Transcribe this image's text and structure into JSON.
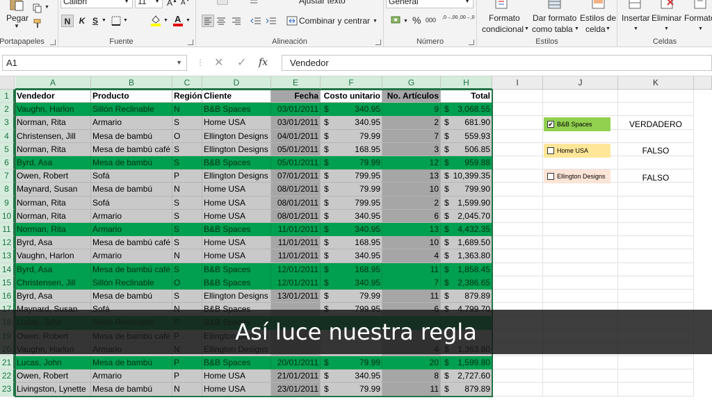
{
  "ribbon": {
    "clipboard": {
      "paste_label": "Pegar",
      "group_label": "Portapapeles"
    },
    "font": {
      "font_name": "Calibri",
      "font_size": "11",
      "bold": "N",
      "italic": "K",
      "underline": "S",
      "group_label": "Fuente",
      "font_color": "#e00000",
      "fill_color": "#ffff00"
    },
    "alignment": {
      "wrap_text": "Ajustar texto",
      "merge_center": "Combinar y centrar",
      "group_label": "Alineación"
    },
    "number": {
      "format": "General",
      "percent": "%",
      "thousands": "000",
      "inc_decimal": ",0→,00",
      "dec_decimal": ",00→,0",
      "group_label": "Número"
    },
    "styles": {
      "conditional_format": [
        "Formato",
        "condicional"
      ],
      "format_table": [
        "Dar formato",
        "como tabla"
      ],
      "cell_styles": [
        "Estilos de",
        "celda"
      ],
      "group_label": "Estilos"
    },
    "cells": {
      "insert": "Insertar",
      "delete": "Eliminar",
      "format": "Formato",
      "group_label": "Celdas"
    }
  },
  "formula_bar": {
    "cell_ref": "A1",
    "content": "Vendedor",
    "fx": "fx"
  },
  "grid": {
    "columns": [
      "A",
      "B",
      "C",
      "D",
      "E",
      "F",
      "G",
      "H",
      "I",
      "J",
      "K"
    ],
    "headers": [
      "Vendedor",
      "Producto",
      "Región",
      "Cliente",
      "Fecha",
      "Costo unitario",
      "No. Artículos",
      "Total"
    ],
    "currency_symbol": "$",
    "rows": [
      {
        "n": "2",
        "hl": true,
        "c": [
          "Vaughn, Harlon",
          "Sillón Reclinable",
          "N",
          "B&B Spaces",
          "03/01/2011",
          "340.95",
          "9",
          "3,068.55"
        ]
      },
      {
        "n": "3",
        "hl": false,
        "c": [
          "Norman, Rita",
          "Armario",
          "S",
          "Home USA",
          "03/01/2011",
          "340.95",
          "2",
          "681.90"
        ]
      },
      {
        "n": "4",
        "hl": false,
        "c": [
          "Christensen, Jill",
          "Mesa de bambú",
          "O",
          "Ellington Designs",
          "04/01/2011",
          "79.99",
          "7",
          "559.93"
        ]
      },
      {
        "n": "5",
        "hl": false,
        "c": [
          "Norman, Rita",
          "Mesa de bambú café",
          "S",
          "Ellington Designs",
          "05/01/2011",
          "168.95",
          "3",
          "506.85"
        ]
      },
      {
        "n": "6",
        "hl": true,
        "c": [
          "Byrd, Asa",
          "Mesa de bambú",
          "S",
          "B&B Spaces",
          "05/01/2011",
          "79.99",
          "12",
          "959.88"
        ]
      },
      {
        "n": "7",
        "hl": false,
        "c": [
          "Owen, Robert",
          "Sofá",
          "P",
          "Ellington Designs",
          "07/01/2011",
          "799.95",
          "13",
          "10,399.35"
        ]
      },
      {
        "n": "8",
        "hl": false,
        "c": [
          "Maynard, Susan",
          "Mesa de bambú",
          "N",
          "Home USA",
          "08/01/2011",
          "79.99",
          "10",
          "799.90"
        ]
      },
      {
        "n": "9",
        "hl": false,
        "c": [
          "Norman, Rita",
          "Sofá",
          "S",
          "Home USA",
          "08/01/2011",
          "799.95",
          "2",
          "1,599.90"
        ]
      },
      {
        "n": "10",
        "hl": false,
        "c": [
          "Norman, Rita",
          "Armario",
          "S",
          "Home USA",
          "08/01/2011",
          "340.95",
          "6",
          "2,045.70"
        ]
      },
      {
        "n": "11",
        "hl": true,
        "c": [
          "Norman, Rita",
          "Armario",
          "S",
          "B&B Spaces",
          "11/01/2011",
          "340.95",
          "13",
          "4,432.35"
        ]
      },
      {
        "n": "12",
        "hl": false,
        "c": [
          "Byrd, Asa",
          "Mesa de bambú café",
          "S",
          "Home USA",
          "11/01/2011",
          "168.95",
          "10",
          "1,689.50"
        ]
      },
      {
        "n": "13",
        "hl": false,
        "c": [
          "Vaughn, Harlon",
          "Armario",
          "N",
          "Home USA",
          "11/01/2011",
          "340.95",
          "4",
          "1,363.80"
        ]
      },
      {
        "n": "14",
        "hl": true,
        "c": [
          "Byrd, Asa",
          "Mesa de bambú café",
          "S",
          "B&B Spaces",
          "12/01/2011",
          "168.95",
          "11",
          "1,858.45"
        ]
      },
      {
        "n": "15",
        "hl": true,
        "c": [
          "Christensen, Jill",
          "Sillón Reclinable",
          "O",
          "B&B Spaces",
          "12/01/2011",
          "340.95",
          "7",
          "2,386.65"
        ]
      },
      {
        "n": "16",
        "hl": false,
        "c": [
          "Byrd, Asa",
          "Mesa de bambú",
          "S",
          "Ellington Designs",
          "13/01/2011",
          "79.99",
          "11",
          "879.89"
        ]
      },
      {
        "n": "17",
        "hl": false,
        "c": [
          "Maynard, Susan",
          "Sofá",
          "N",
          "B&B Spaces",
          "",
          "799.95",
          "6",
          "4,799.70"
        ]
      },
      {
        "n": "18",
        "hl": true,
        "c": [
          "Lucas, John",
          "Sillón Reclinable",
          "P",
          "B&B Spaces",
          "",
          "",
          "",
          ""
        ]
      },
      {
        "n": "19",
        "hl": false,
        "c": [
          "Owen, Robert",
          "Mesa de bambú café",
          "P",
          "Ellington Designs",
          "",
          "",
          "",
          ""
        ]
      },
      {
        "n": "20",
        "hl": false,
        "c": [
          "Vaughn, Harlon",
          "Armario",
          "N",
          "Ellington Designs",
          "",
          "",
          "4",
          "1,363.80"
        ]
      },
      {
        "n": "21",
        "hl": true,
        "c": [
          "Lucas, John",
          "Mesa de bambú",
          "P",
          "B&B Spaces",
          "20/01/2011",
          "79.99",
          "20",
          "1,599.80"
        ]
      },
      {
        "n": "22",
        "hl": false,
        "c": [
          "Owen, Robert",
          "Armario",
          "P",
          "Home USA",
          "21/01/2011",
          "340.95",
          "8",
          "2,727.60"
        ]
      },
      {
        "n": "23",
        "hl": false,
        "c": [
          "Livingston, Lynette",
          "Mesa de bambú",
          "N",
          "Home USA",
          "23/01/2011",
          "79.99",
          "11",
          "879.89"
        ]
      }
    ]
  },
  "controls": {
    "checkboxes": [
      {
        "label": "B&B Spaces",
        "checked": true,
        "mark": "✔",
        "bg": "#92d050",
        "result": "VERDADERO"
      },
      {
        "label": "Home USA",
        "checked": false,
        "mark": "",
        "bg": "#ffe699",
        "result": "FALSO"
      },
      {
        "label": "Ellington Designs",
        "checked": false,
        "mark": "",
        "bg": "#fce4d6",
        "result": "FALSO"
      }
    ]
  },
  "overlay": {
    "caption": "Así luce nuestra regla"
  },
  "colors": {
    "accent": "#217346",
    "highlight": "#00a050",
    "row_light": "#c9c9c9",
    "row_dark": "#a6a6a6"
  }
}
